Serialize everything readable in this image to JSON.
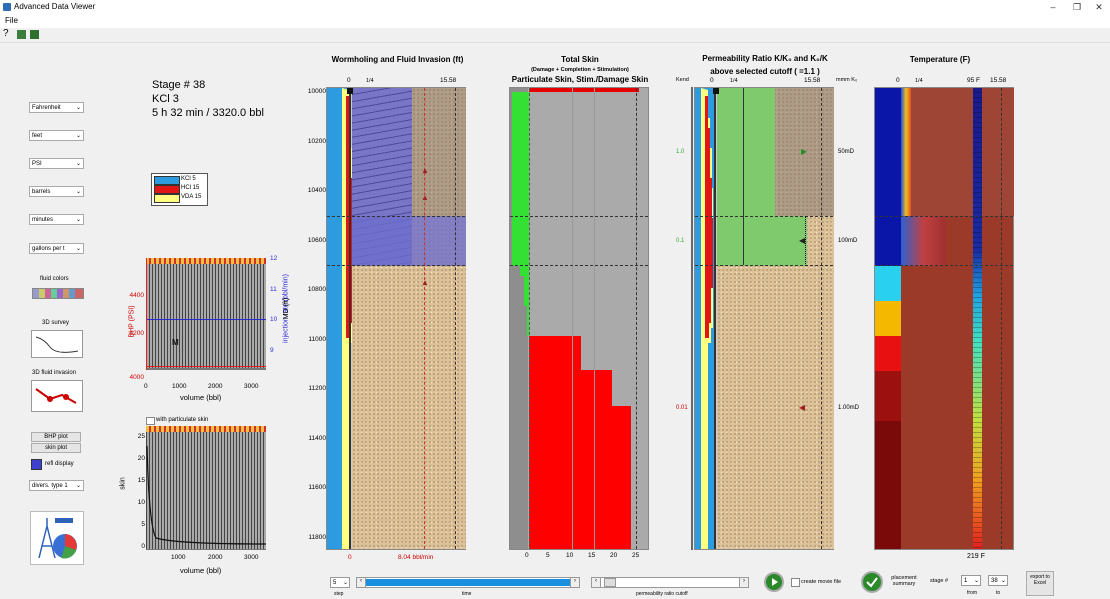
{
  "window": {
    "title": "Advanced Data Viewer"
  },
  "menu": {
    "file": "File"
  },
  "units": {
    "temperature": "Fahrenheit",
    "length": "feet",
    "pressure": "PSI",
    "volume": "barrels",
    "time": "minutes",
    "concentration": "gallons per t"
  },
  "left_panel": {
    "fluid_colors_label": "fluid colors",
    "survey_label": "3D survey",
    "fluid_invasion_label": "3D fluid invasion",
    "bhp_plot_label": "BHP plot",
    "skin_plot_label": "skin plot",
    "refl_display_label": "refl display",
    "diverter_select": "divers. type 1"
  },
  "stage_info": {
    "line1": "Stage # 38",
    "line2": "KCl 3",
    "line3": "5 h 32 min  / 3320.0 bbl"
  },
  "legend": [
    {
      "name": "KCl 5",
      "color": "#2c9be0"
    },
    {
      "name": "HCl 15",
      "color": "#e01616"
    },
    {
      "name": "VDA 15",
      "color": "#ffff80"
    }
  ],
  "bhp_chart": {
    "y_ticks_left": [
      "4400",
      "4200",
      "4000"
    ],
    "y_ticks_right": [
      "12",
      "11",
      "10",
      "9"
    ],
    "x_ticks": [
      "0",
      "1000",
      "2000",
      "3000"
    ],
    "ylabel_left": "BHP (PSI)",
    "ylabel_right": "injection rate (bbl/min)",
    "xlabel": "volume (bbl)",
    "marker": "M"
  },
  "skin_chart": {
    "legend": "with particulate skin",
    "y_ticks": [
      "25",
      "20",
      "15",
      "10",
      "5",
      "0"
    ],
    "x_ticks": [
      "1000",
      "2000",
      "3000"
    ],
    "ylabel": "skin",
    "xlabel": "volume (bbl)"
  },
  "md_axis": {
    "label": "MD (ft)",
    "ticks": [
      "10000",
      "10200",
      "10400",
      "10600",
      "10800",
      "11000",
      "11200",
      "11400",
      "11600",
      "11800"
    ]
  },
  "wormhole_panel": {
    "title": "Wormholing and Fluid Invasion (ft)",
    "top_left": "0",
    "top_mid": "1/4",
    "top_right": "15.58",
    "rate": "8.04 bbl/min",
    "bottom_zero": "0"
  },
  "skin_panel": {
    "title": "Total Skin",
    "subtitle": "(Damage + Completion + Stimulation)",
    "title2": "Particulate Skin, Stim./Damage Skin",
    "x_ticks": [
      "0",
      "5",
      "10",
      "15",
      "20",
      "25"
    ]
  },
  "perm_panel": {
    "title": "Permeability Ratio K/K₀ and K₀/K",
    "subtitle": "above selected cutoff ( =1.1 )",
    "k_label": "Kend",
    "top_left": "0",
    "top_mid": "1/4",
    "top_right": "15.58",
    "units_k": "mmm K₀",
    "left_values": [
      "1.0",
      "0.1",
      "0.01"
    ],
    "right_values": [
      "50mD",
      "100mD",
      "1.00mD"
    ]
  },
  "temp_panel": {
    "title": "Temperature (F)",
    "top_left": "0",
    "top_mid": "1/4",
    "top_temp": "95 F",
    "top_right": "15.58",
    "bottom_temp": "219 F"
  },
  "bottom_bar": {
    "step_value": "5",
    "step_label": "step",
    "time_label": "time",
    "perm_label": "permeability ratio cutoff",
    "movie_label": "create movie file",
    "placement_label": "placement summary",
    "stage_label": "stage #",
    "from_value": "1",
    "to_value": "38",
    "from_label": "from",
    "to_label": "to",
    "export_label": "export to Excel",
    "time_progress": 1.0,
    "perm_cutoff": 0.02
  }
}
